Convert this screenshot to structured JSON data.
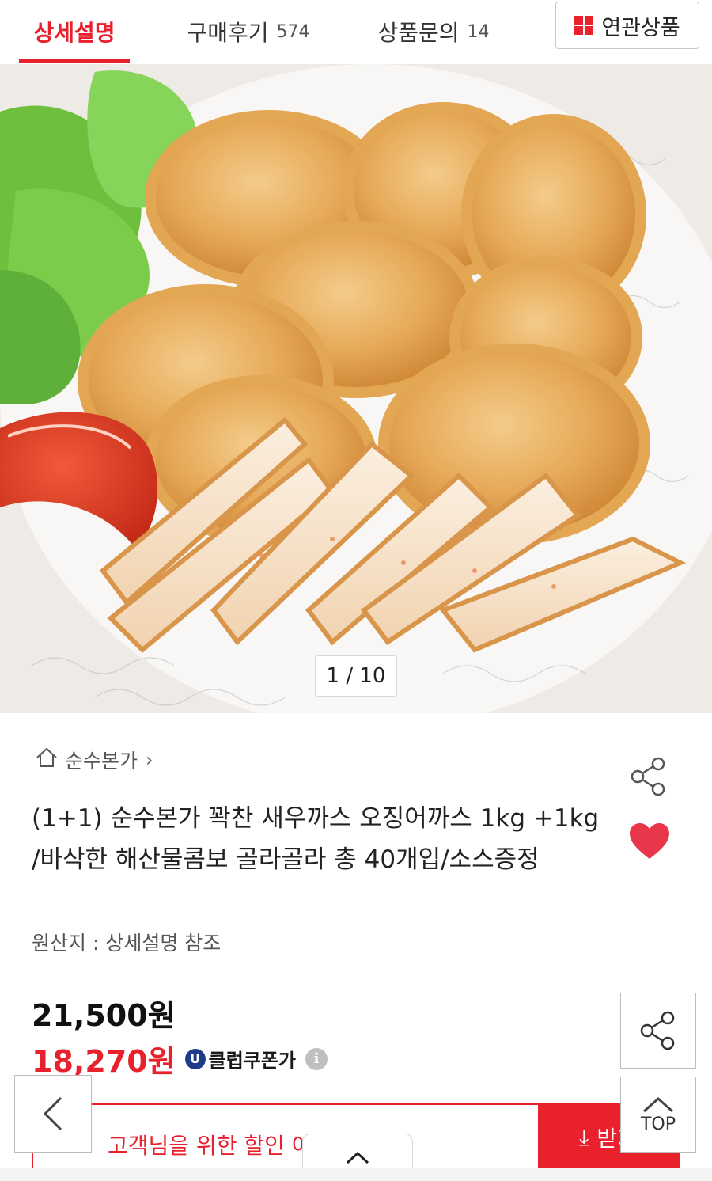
{
  "tabs": {
    "detail": {
      "label": "상세설명"
    },
    "review": {
      "label": "구매후기",
      "count": "574"
    },
    "qna": {
      "label": "상품문의",
      "count": "14"
    },
    "related": {
      "label": "연관상품",
      "icon": "grid-icon"
    }
  },
  "hero": {
    "image": "fried-cutlets-photo",
    "counter": "1 / 10"
  },
  "product": {
    "store": "순수본가",
    "title": "(1+1) 순수본가 꽉찬 새우까스 오징어까스 1kg +1kg /바삭한 해산물콤보 골라골라 총 40개입/소스증정",
    "origin": "원산지 : 상세설명 참조",
    "price_original": "21,500원",
    "price_sale": "18,270원",
    "coupon_badge": "U",
    "coupon_label": "클럽쿠폰가",
    "info_icon": "i"
  },
  "bottom": {
    "coupon_message": "고객님을 위한 할인                    어요!",
    "get_label": "받기",
    "top_label": "TOP"
  },
  "colors": {
    "accent": "#e8212d",
    "uclub": "#1e3a8a"
  }
}
